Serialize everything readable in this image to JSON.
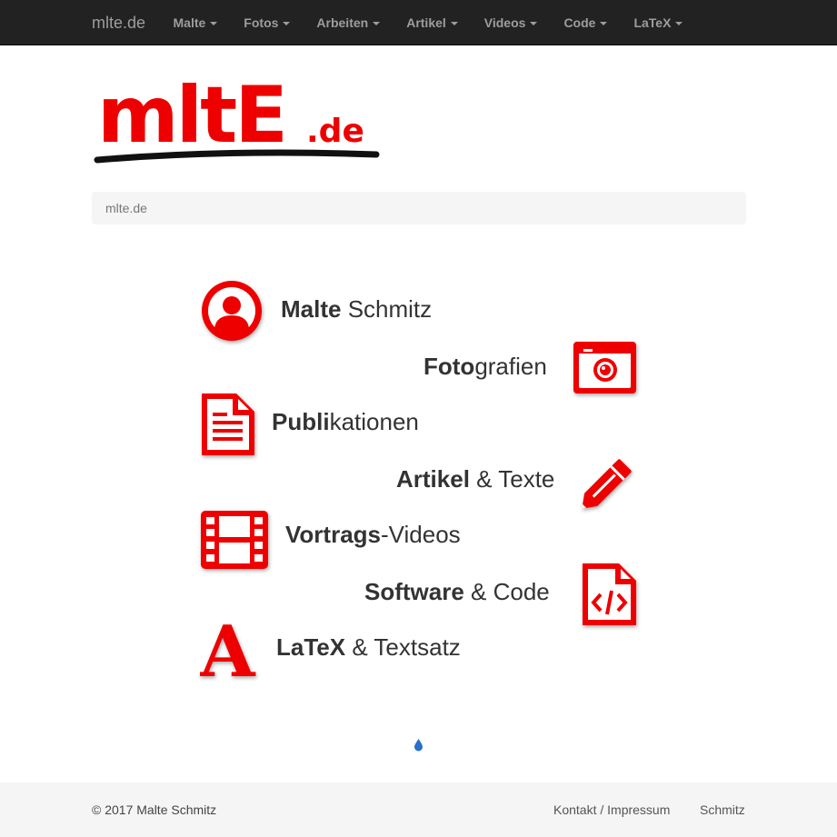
{
  "navbar": {
    "brand": "mlte.de",
    "menu": [
      {
        "label": "Malte"
      },
      {
        "label": "Fotos"
      },
      {
        "label": "Arbeiten"
      },
      {
        "label": "Artikel"
      },
      {
        "label": "Videos"
      },
      {
        "label": "Code"
      },
      {
        "label": "LaTeX"
      }
    ]
  },
  "logo": {
    "text": "mltE.de",
    "color": "#ee0000"
  },
  "breadcrumb": {
    "current": "mlte.de"
  },
  "entries": [
    {
      "bold": "Malte",
      "rest": " Schmitz",
      "icon": "user-circle-icon"
    },
    {
      "bold": "Foto",
      "rest": "grafien",
      "icon": "camera-icon"
    },
    {
      "bold": "Publi",
      "rest": "kationen",
      "icon": "document-icon"
    },
    {
      "bold": "Artikel",
      "rest": " & Texte",
      "icon": "pencil-icon"
    },
    {
      "bold": "Vortrags",
      "rest": "-Videos",
      "icon": "film-icon"
    },
    {
      "bold": "Software",
      "rest": " & Code",
      "icon": "code-file-icon"
    },
    {
      "bold": "LaTeX",
      "rest": " & Textsatz",
      "icon": "latex-a-icon"
    }
  ],
  "footer": {
    "copyright": "© 2017 Malte Schmitz",
    "links": [
      "Kontakt / Impressum",
      "Schmitz"
    ]
  },
  "colors": {
    "accent": "#ee0000",
    "navbar": "#222222",
    "footer_bg": "#f5f5f5",
    "drop": "#2a6fc9"
  }
}
